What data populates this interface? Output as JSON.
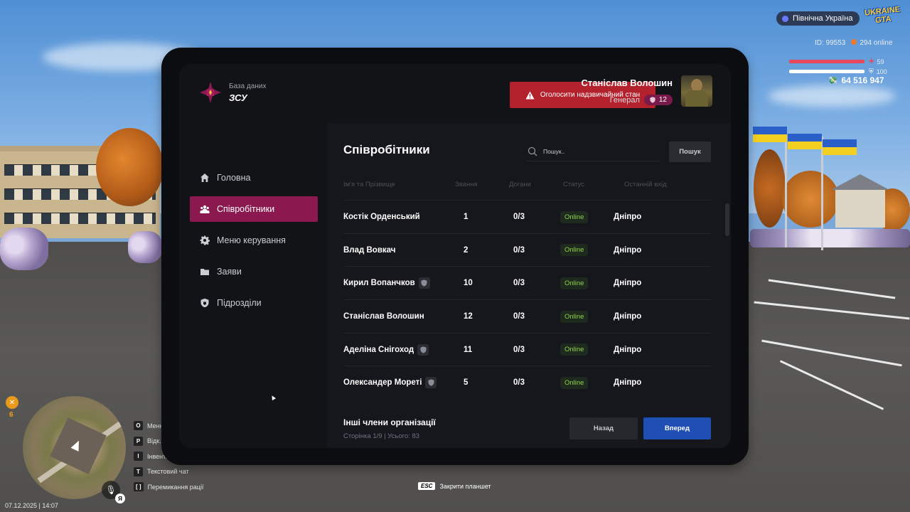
{
  "hud": {
    "region": "Північна Україна",
    "logo_text": "UKRAINE GTA",
    "id_text": "ID: 99553",
    "online_text": "294 online",
    "health": "59",
    "armor": "100",
    "money": "64 516 947",
    "fork_count": "6",
    "lang": "Я",
    "datetime": "07.12.2025 | 14:07",
    "hotkeys": [
      {
        "key": "O",
        "label": "Меню"
      },
      {
        "key": "P",
        "label": "Відк..."
      },
      {
        "key": "I",
        "label": "Інвент..."
      },
      {
        "key": "T",
        "label": "Текстовий чат"
      },
      {
        "key": "[ ]",
        "label": "Перемикання рації"
      }
    ],
    "esc_key": "ESC",
    "esc_label": "Закрити планшет",
    "health_color": "#e8475b",
    "armor_color": "#ffffff"
  },
  "tablet": {
    "brand_sub": "База даних",
    "brand_main": "ЗСУ",
    "alert_label": "Оголосити надзвичайний стан",
    "user": {
      "name": "Станіслав Волошин",
      "rank": "Генерал",
      "level": "12"
    },
    "nav": [
      {
        "label": "Головна",
        "icon": "home-icon"
      },
      {
        "label": "Співробітники",
        "icon": "users-icon",
        "active": true
      },
      {
        "label": "Меню керування",
        "icon": "gear-icon"
      },
      {
        "label": "Заяви",
        "icon": "folder-icon"
      },
      {
        "label": "Підрозділи",
        "icon": "shield-icon"
      }
    ],
    "page_title": "Співробітники",
    "search_placeholder": "Пошук..",
    "search_button": "Пошук",
    "columns": [
      "Ім'я та Прізвище",
      "Звання",
      "Догани",
      "Статус",
      "Останній вхід"
    ],
    "rows": [
      {
        "name": "Костік Орденський",
        "rank": "1",
        "warnings": "0/3",
        "status": "Online",
        "last": "Дніпро",
        "leader": false
      },
      {
        "name": "Влад Вовкач",
        "rank": "2",
        "warnings": "0/3",
        "status": "Online",
        "last": "Дніпро",
        "leader": false
      },
      {
        "name": "Кирил Вопанчков",
        "rank": "10",
        "warnings": "0/3",
        "status": "Online",
        "last": "Дніпро",
        "leader": true
      },
      {
        "name": "Станіслав Волошин",
        "rank": "12",
        "warnings": "0/3",
        "status": "Online",
        "last": "Дніпро",
        "leader": false
      },
      {
        "name": "Аделіна Снігоход",
        "rank": "11",
        "warnings": "0/3",
        "status": "Online",
        "last": "Дніпро",
        "leader": true
      },
      {
        "name": "Олександер Мореті",
        "rank": "5",
        "warnings": "0/3",
        "status": "Online",
        "last": "Дніпро",
        "leader": true
      }
    ],
    "footer_title": "Інші члени організації",
    "footer_pages": "Сторінка 1/9 | Усього: 83",
    "back_button": "Назад",
    "next_button": "Вперед",
    "accent": "#8b1950",
    "alert_color": "#b3222c",
    "next_color": "#1f4fb3",
    "online_color": "#8fd14b"
  }
}
